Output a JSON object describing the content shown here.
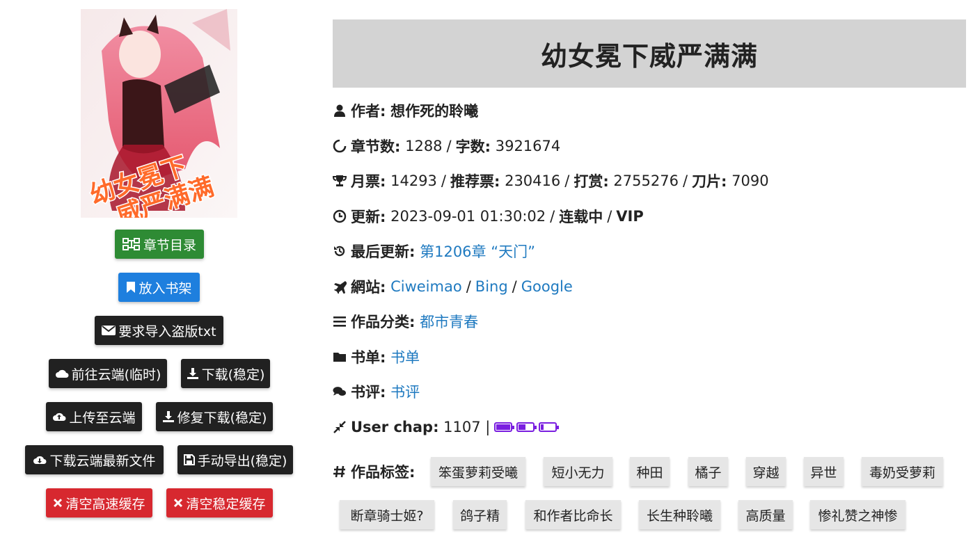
{
  "cover": {
    "title_text": "幼女冕下威严满满"
  },
  "buttons": {
    "chapter_list": "章节目录",
    "bookshelf": "放入书架",
    "request_import": "要求导入盗版txt",
    "goto_cloud": "前往云端(临时)",
    "download_stable": "下载(稳定)",
    "upload_cloud": "上传至云端",
    "repair_download": "修复下载(稳定)",
    "download_cloud_latest": "下载云端最新文件",
    "manual_export": "手动导出(稳定)",
    "clear_fast_cache": "清空高速缓存",
    "clear_stable_cache": "清空稳定缓存"
  },
  "book": {
    "title": "幼女冕下威严满满",
    "author_label": "作者:",
    "author": "想作死的聆曦",
    "chapters_label": "章节数:",
    "chapters": "1288",
    "words_label": "字数:",
    "words": "3921674",
    "monthly_label": "月票:",
    "monthly": "14293",
    "recommend_label": "推荐票:",
    "recommend": "230416",
    "reward_label": "打赏:",
    "reward": "2755276",
    "blade_label": "刀片:",
    "blade": "7090",
    "update_label": "更新:",
    "update_time": "2023-09-01 01:30:02",
    "status": "连载中",
    "vip": "VIP",
    "last_update_label": "最后更新:",
    "last_chapter": "第1206章 “天门”",
    "site_label": "網站:",
    "sites": [
      "Ciweimao",
      "Bing",
      "Google"
    ],
    "category_label": "作品分类:",
    "category": "都市青春",
    "booklist_label": "书单:",
    "booklist": "书单",
    "review_label": "书评:",
    "review": "书评",
    "user_chap_label": "User chap:",
    "user_chap": "1107",
    "user_chap_sep": "|",
    "battery_levels": [
      1.0,
      0.5,
      0.2
    ],
    "tags_label": "作品标签:",
    "tags": [
      "笨蛋萝莉受曦",
      "短小无力",
      "种田",
      "橘子",
      "穿越",
      "异世",
      "毒奶受萝莉",
      "断章骑士姬?",
      "鸽子精",
      "和作者比命长",
      "长生种聆曦",
      "高质量",
      "惨礼赞之神惨"
    ]
  },
  "colors": {
    "link": "#1f7ac0",
    "battery": "#7a1fe0",
    "title_bg": "#d3d3d3"
  }
}
